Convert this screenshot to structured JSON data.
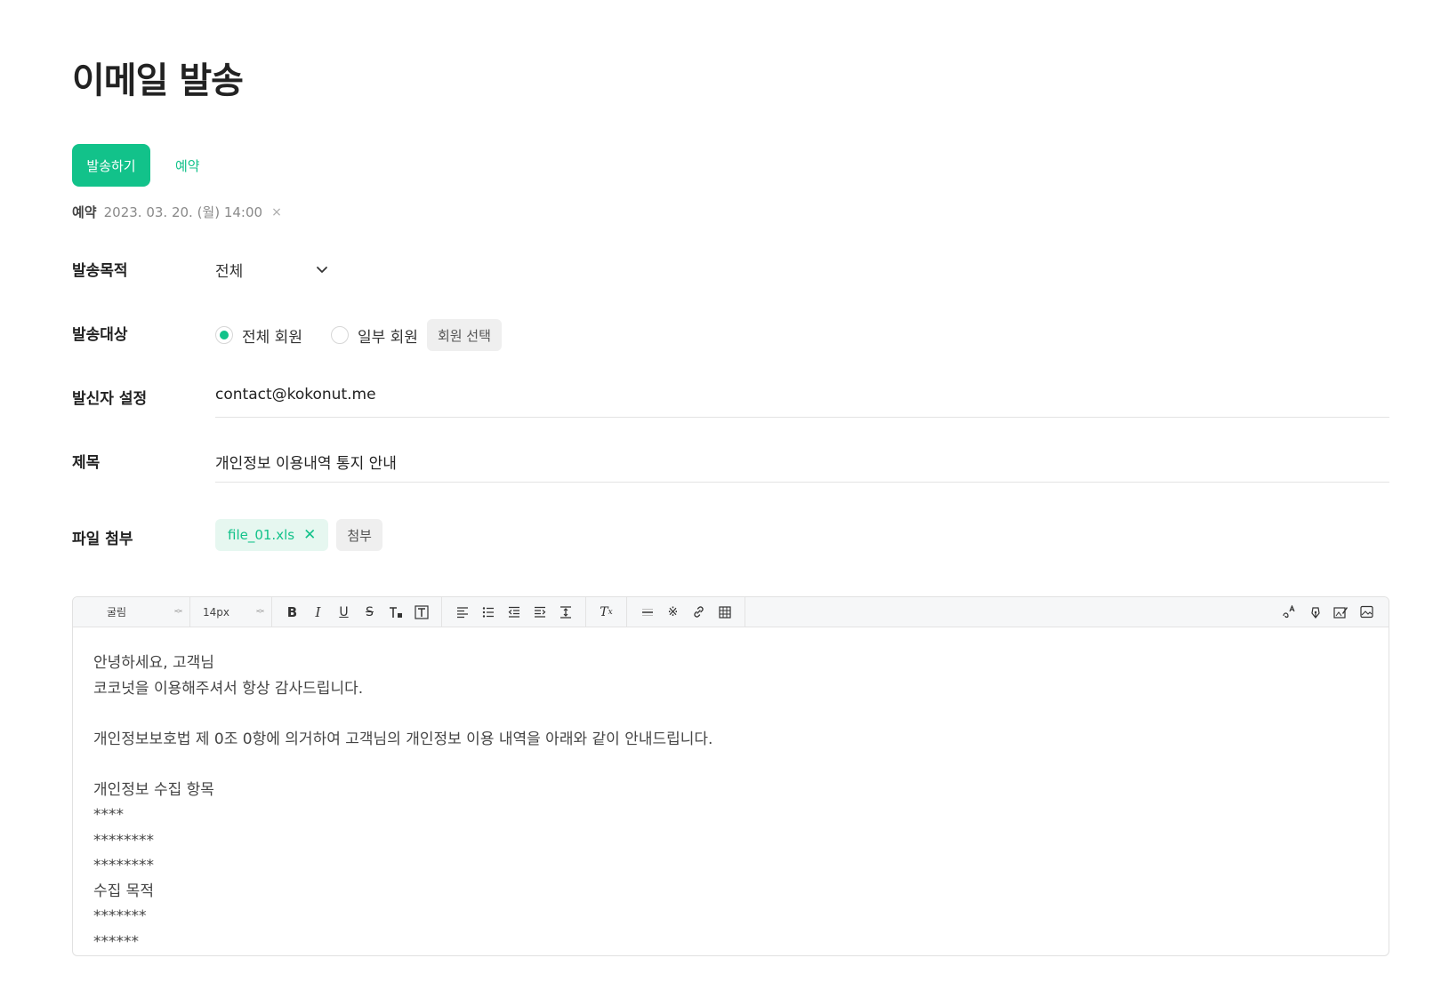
{
  "page": {
    "title": "이메일 발송"
  },
  "actions": {
    "send_label": "발송하기",
    "reserve_label": "예약"
  },
  "reservation": {
    "label": "예약",
    "datetime": "2023. 03. 20. (월) 14:00",
    "clear_glyph": "×"
  },
  "form": {
    "purpose": {
      "label": "발송목적",
      "value": "전체"
    },
    "target": {
      "label": "발송대상",
      "options": [
        {
          "label": "전체 회원",
          "selected": true
        },
        {
          "label": "일부 회원",
          "selected": false
        }
      ],
      "member_select_label": "회원 선택"
    },
    "sender": {
      "label": "발신자 설정",
      "value": "contact@kokonut.me"
    },
    "subject": {
      "label": "제목",
      "value": "개인정보 이용내역 통지 안내"
    },
    "attachment": {
      "label": "파일 첨부",
      "file_name": "file_01.xls",
      "remove_glyph": "✕",
      "attach_label": "첨부"
    }
  },
  "editor": {
    "toolbar": {
      "font_family": "굴림",
      "font_size": "14px",
      "icons": [
        "bold-icon",
        "italic-icon",
        "underline-icon",
        "strikethrough-icon",
        "text-color-icon",
        "text-background-icon",
        "align-left-icon",
        "bullet-list-icon",
        "outdent-icon",
        "indent-icon",
        "line-height-icon",
        "clear-format-icon",
        "horizontal-rule-icon",
        "special-char-icon",
        "link-icon",
        "table-icon",
        "spell-check-icon",
        "signature-icon",
        "edit-image-icon",
        "image-icon"
      ]
    },
    "body_lines": [
      "안녕하세요, 고객님",
      "코코넛을 이용해주셔서 항상 감사드립니다.",
      "",
      "개인정보보호법 제 0조 0항에 의거하여 고객님의 개인정보 이용 내역을 아래와 같이 안내드립니다.",
      "",
      "개인정보 수집 항목",
      "****",
      "********",
      "********",
      "수집 목적",
      "*******",
      "******"
    ]
  },
  "colors": {
    "accent": "#12c28a",
    "chip_bg": "#e6f7f0",
    "neutral_button_bg": "#efefef"
  }
}
